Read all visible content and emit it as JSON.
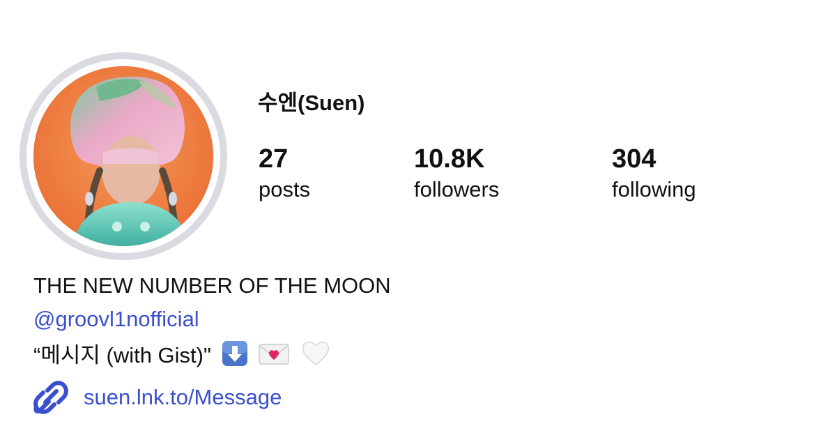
{
  "profile": {
    "username": "수엔(Suen)",
    "avatar_icon": "profile-photo"
  },
  "stats": {
    "posts": {
      "value": "27",
      "label": "posts"
    },
    "followers": {
      "value": "10.8K",
      "label": "followers"
    },
    "following": {
      "value": "304",
      "label": "following"
    }
  },
  "bio": {
    "headline": "THE NEW NUMBER OF THE MOON",
    "mention": "@groovl1nofficial",
    "song": "“메시지 (with Gist)\"",
    "emojis": [
      "down-arrow-emoji",
      "love-letter-emoji",
      "white-heart-emoji"
    ]
  },
  "link": {
    "icon": "link-icon",
    "text": "suen.lnk.to/Message"
  },
  "colors": {
    "link": "#3a4fcc",
    "avatar_ring": "#dadbe0",
    "avatar_background": "#f07b3f"
  }
}
